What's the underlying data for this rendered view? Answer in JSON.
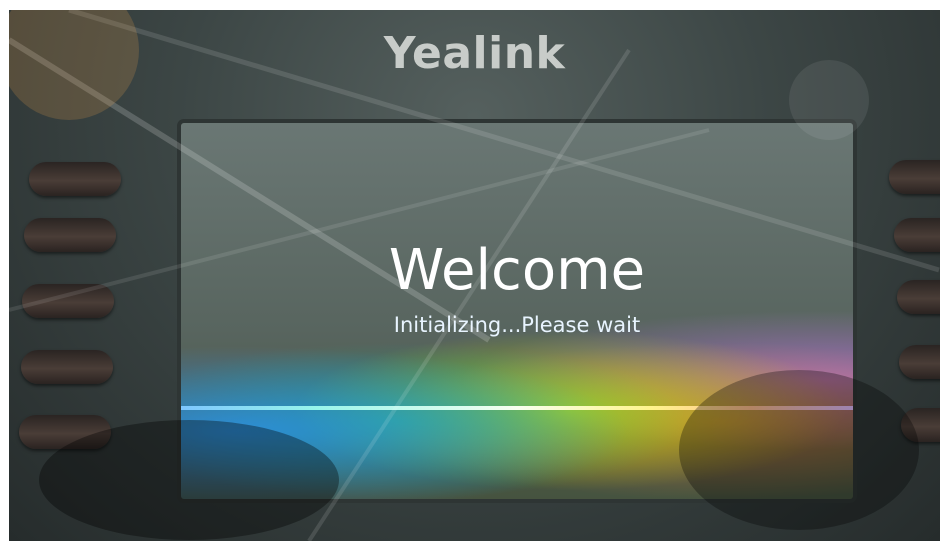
{
  "phone": {
    "brand": "Yealink",
    "line_keys_left_count": 5,
    "line_keys_right_count": 5
  },
  "screen": {
    "title": "Welcome",
    "status": "Initializing...Please wait",
    "progress_fraction": 1.0
  },
  "colors": {
    "background": "#3c4645",
    "screen": "#5e6b68",
    "text": "#ffffff",
    "progress_start": "#38a9ff",
    "progress_mid": "#ffef50",
    "progress_end": "#d39bff"
  }
}
